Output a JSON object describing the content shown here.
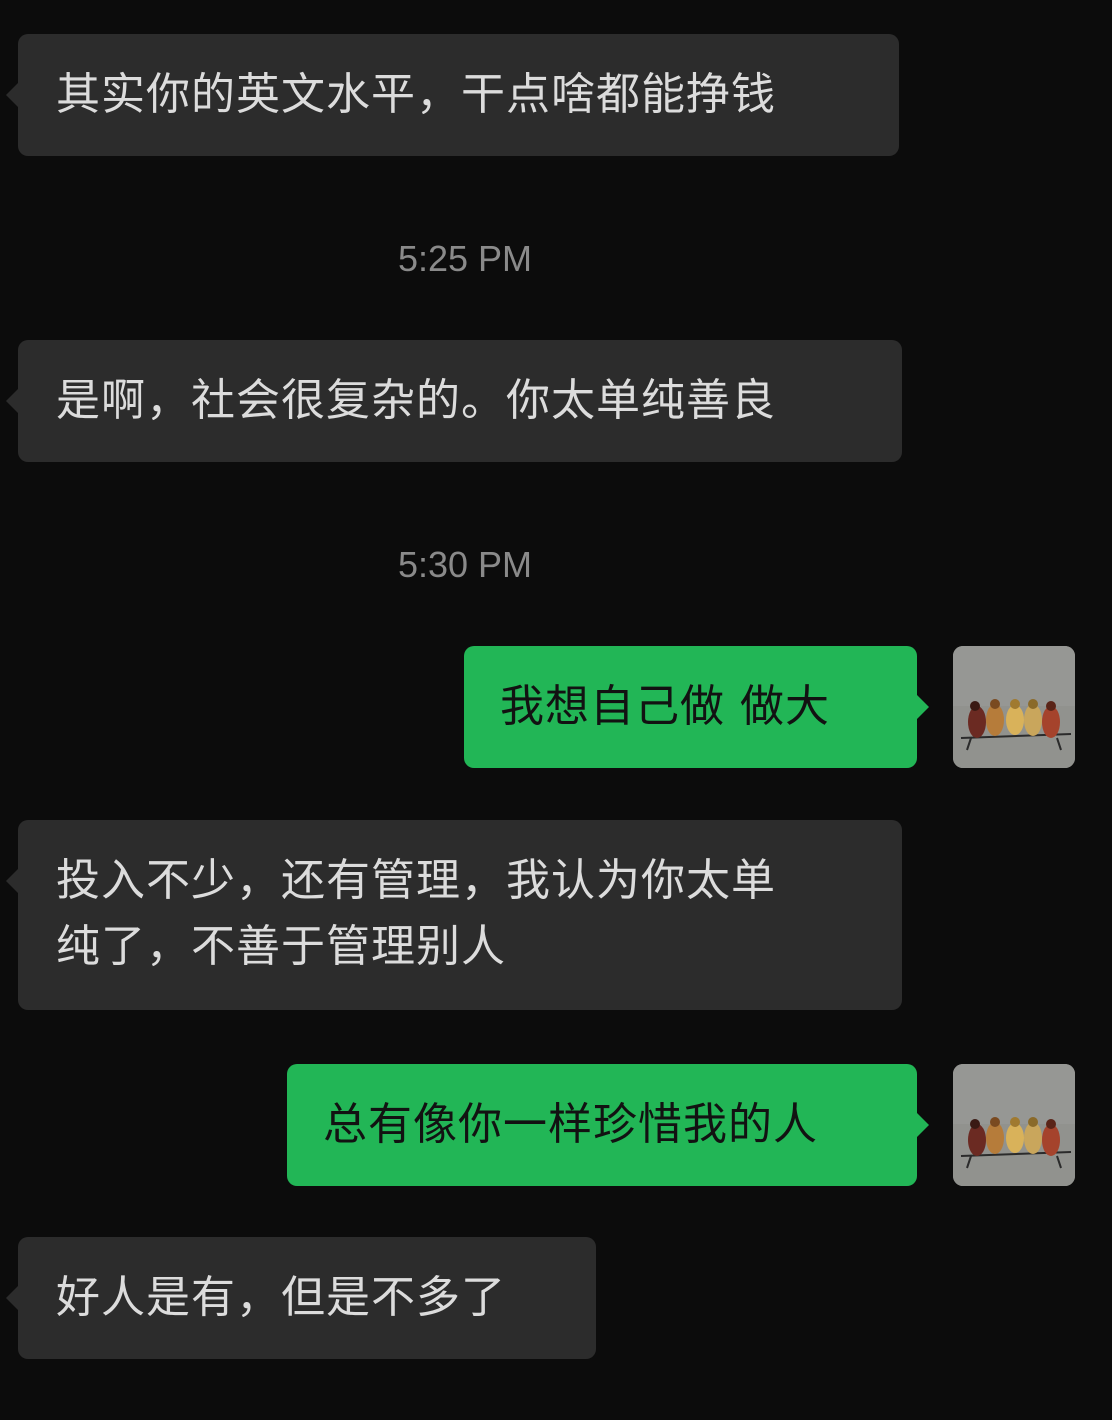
{
  "messages": [
    {
      "text": "其实你的英文水平，干点啥都能挣钱"
    },
    {
      "time": "5:25 PM"
    },
    {
      "text": "是啊，社会很复杂的。你太单纯善良"
    },
    {
      "time": "5:30 PM"
    },
    {
      "text": "我想自己做 做大"
    },
    {
      "text": "投入不少，还有管理，我认为你太单",
      "text2": "纯了，不善于管理别人"
    },
    {
      "text": "总有像你一样珍惜我的人"
    },
    {
      "text": "好人是有，但是不多了"
    }
  ],
  "avatar_icon": "birds-painting-avatar",
  "colors": {
    "background": "#0c0c0c",
    "incoming_bubble": "#2c2c2c",
    "outgoing_bubble": "#22b656",
    "timestamp": "#8a8a8a"
  }
}
